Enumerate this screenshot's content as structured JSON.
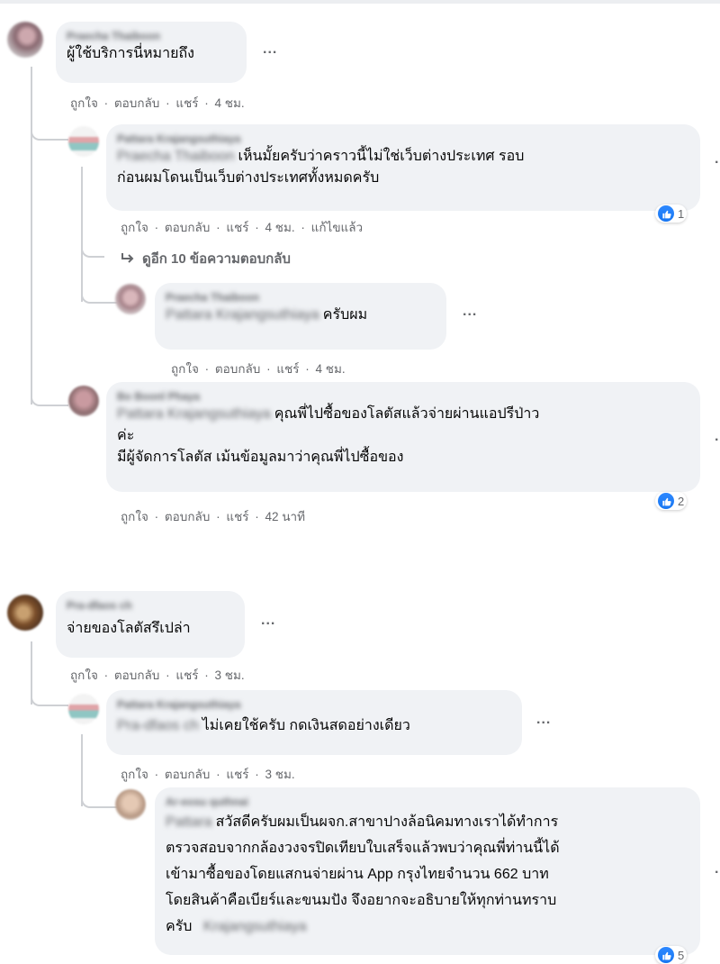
{
  "comments": {
    "c1": {
      "author": "Praecha Thaiboon",
      "text": "ผู้ใช้บริการนี่หมายถึง",
      "time": "4 ชม."
    },
    "r1": {
      "author": "Pattara Krajangsuthiaya",
      "mention": "Praecha Thaiboon",
      "text_line1": "เห็นมั้ยครับว่าคราวนี้ไม่ใช่เว็บต่างประเทศ รอบ",
      "text_line2": "ก่อนผมโดนเป็นเว็บต่างประเทศทั้งหมดครับ",
      "time": "4 ชม.",
      "edited": "แก้ไขแล้ว",
      "reactions": "1"
    },
    "more_replies": "ดูอีก 10 ข้อความตอบกลับ",
    "r2": {
      "author": "Praecha Thaiboon",
      "mention": "Pattara Krajangsuthiaya",
      "text": "ครับผม",
      "time": "4 ชม."
    },
    "r3": {
      "author": "Bo Boonl Phaya",
      "mention": "Pattara Krajangsuthiaya",
      "text_line1": "คุณพี่ไปซื้อของโลตัสแล้วจ่ายผ่านแอปรีป่าว",
      "text_line2": "ค่ะ",
      "text_line3": "มีผู้จัดการโลตัส เม้นข้อมูลมาว่าคุณพี่ไปซื้อของ",
      "time": "42 นาที",
      "reactions": "2"
    },
    "c2": {
      "author": "Pra-dfaos ch",
      "text": "จ่ายของโลตัสรึเปล่า",
      "time": "3 ชม."
    },
    "r4": {
      "author": "Pattara Krajangsuthiaya",
      "mention": "Pra-dfaos ch",
      "text": "ไม่เคยใช้ครับ กดเงินสดอย่างเดียว",
      "time": "3 ชม."
    },
    "r5": {
      "author": "Ar-eosu quthnai",
      "mention": "Pattara",
      "mention_tail": "Krajangsuthiaya",
      "text_line1": "สวัสดีครับผมเป็นผจก.สาขาปางล้อนิคมทางเราได้ทำการ",
      "text_line2": "ตรวจสอบจากกล้องวงจรปิดเทียบใบเสร็จแล้วพบว่าคุณพี่ท่านนี้ได้",
      "text_line3": "เข้ามาซื้อของโดยแสกนจ่ายผ่าน App กรุงไทยจำนวน 662 บาท",
      "text_line4": "โดยสินค้าคือเบียร์และขนมปัง จึงอยากจะอธิบายให้ทุกท่านทราบ",
      "text_line5": "ครับ",
      "reactions": "5"
    }
  },
  "actions": {
    "like": "ถูกใจ",
    "reply": "ตอบกลับ",
    "share": "แชร์",
    "sep": "·"
  },
  "ui": {
    "more_dots": "...",
    "edge_dot": "·"
  }
}
